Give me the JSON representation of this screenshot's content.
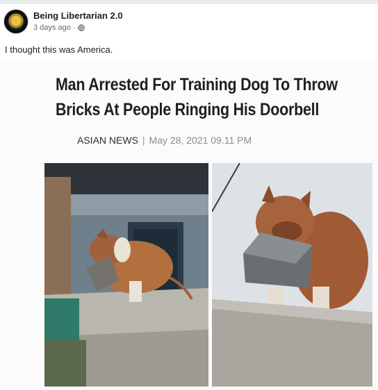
{
  "post": {
    "page_name": "Being Libertarian 2.0",
    "time": "3 days ago",
    "privacy_icon": "globe-icon",
    "caption": "I thought this was America."
  },
  "article": {
    "headline_line1": "Man Arrested For Training Dog To Throw",
    "headline_line2": "Bricks At People Ringing His Doorbell",
    "source": "ASIAN NEWS",
    "separator": "|",
    "date": "May 28, 2021 09.11 PM"
  },
  "photos": [
    {
      "name": "dog-on-wall-left",
      "subject": "dog lying on concrete wall with brick"
    },
    {
      "name": "dog-holding-brick-right",
      "subject": "dog holding brick in mouth on wall"
    }
  ],
  "colors": {
    "text": "#1c1e21",
    "muted": "#65676b",
    "divider": "#e9ebee"
  }
}
